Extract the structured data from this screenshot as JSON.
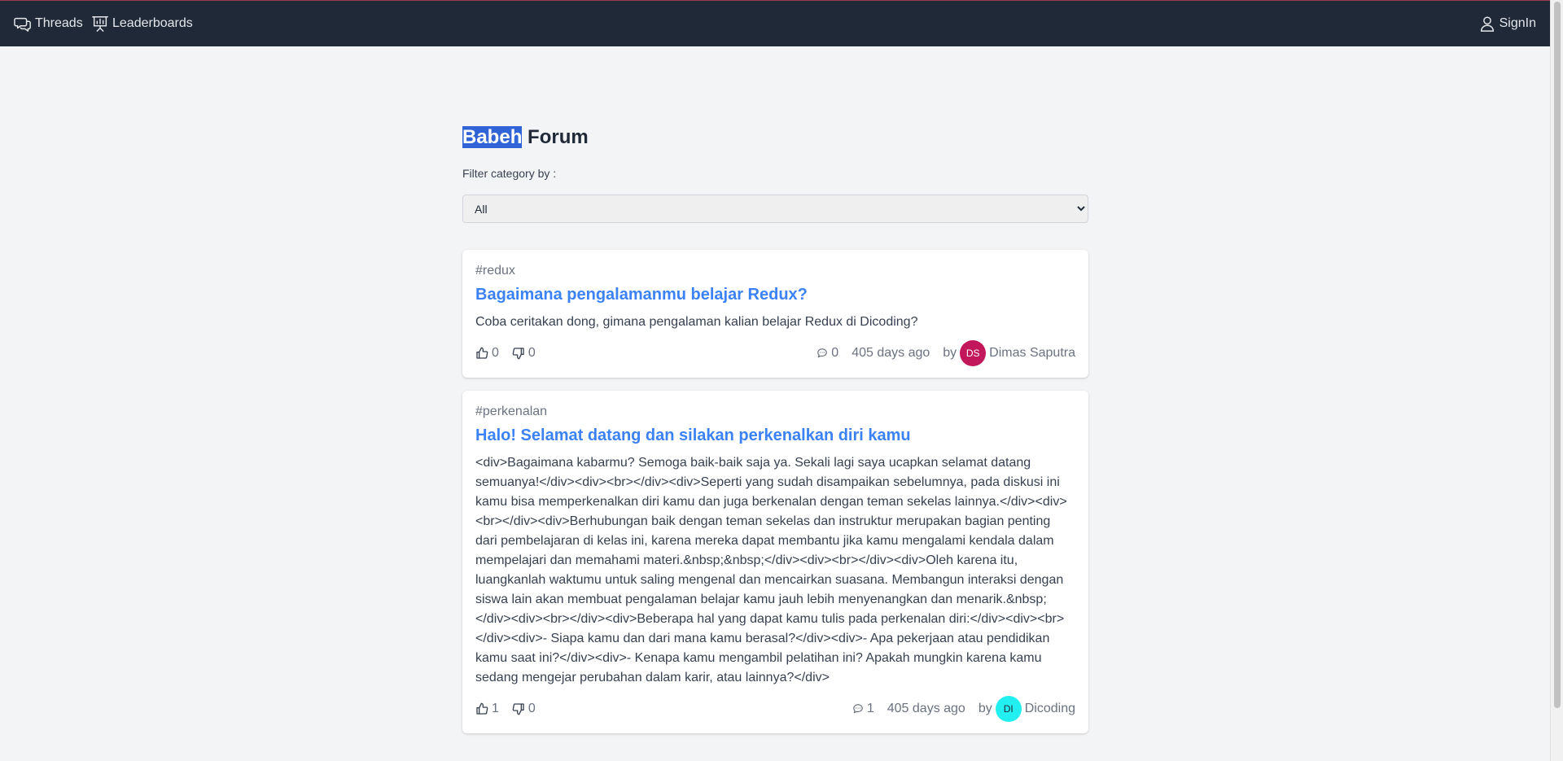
{
  "nav": {
    "threads_label": "Threads",
    "leaderboards_label": "Leaderboards",
    "signin_label": "SignIn"
  },
  "page": {
    "title_highlight": "Babeh",
    "title_rest": " Forum",
    "filter_label": "Filter category by :",
    "filter_value": "All"
  },
  "threads": [
    {
      "category": "#redux",
      "title": "Bagaimana pengalamanmu belajar Redux?",
      "body": "Coba ceritakan dong, gimana pengalaman kalian belajar Redux di Dicoding?",
      "upvotes": "0",
      "downvotes": "0",
      "comments": "0",
      "time": "405 days ago",
      "by": "by",
      "author_initials": "DS",
      "author_name": "Dimas Saputra",
      "avatar_bg": "#c2185b",
      "avatar_fg": "#ffffff"
    },
    {
      "category": "#perkenalan",
      "title": "Halo! Selamat datang dan silakan perkenalkan diri kamu",
      "body": "<div>Bagaimana kabarmu? Semoga baik-baik saja ya. Sekali lagi saya ucapkan selamat datang semuanya!</div><div><br></div><div>Seperti yang sudah disampaikan sebelumnya, pada diskusi ini kamu bisa memperkenalkan diri kamu dan juga berkenalan dengan teman sekelas lainnya.</div><div><br></div><div>Berhubungan baik dengan teman sekelas dan instruktur merupakan bagian penting dari pembelajaran di kelas ini, karena mereka dapat membantu jika kamu mengalami kendala dalam mempelajari dan memahami materi.&nbsp;&nbsp;</div><div><br></div><div>Oleh karena itu, luangkanlah waktumu untuk saling mengenal dan mencairkan suasana. Membangun interaksi dengan siswa lain akan membuat pengalaman belajar kamu jauh lebih menyenangkan dan menarik.&nbsp;</div><div><br></div><div>Beberapa hal yang dapat kamu tulis pada perkenalan diri:</div><div><br></div><div>- Siapa kamu dan dari mana kamu berasal?</div><div>- Apa pekerjaan atau pendidikan kamu saat ini?</div><div>- Kenapa kamu mengambil pelatihan ini? Apakah mungkin karena kamu sedang mengejar perubahan dalam karir, atau lainnya?</div>",
      "upvotes": "1",
      "downvotes": "0",
      "comments": "1",
      "time": "405 days ago",
      "by": "by",
      "author_initials": "DI",
      "author_name": "Dicoding",
      "avatar_bg": "#22f0f0",
      "avatar_fg": "#1f2937"
    }
  ]
}
